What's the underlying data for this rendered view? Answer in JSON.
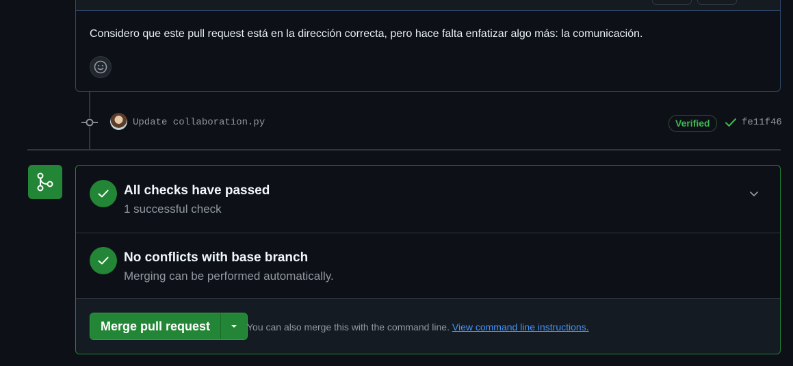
{
  "comment": {
    "body": "Considero que este pull request está en la dirección correcta, pero hace falta enfatizar algo más: la comunicación.",
    "reaction_icon": "smiley-icon"
  },
  "commit": {
    "message": "Update collaboration.py",
    "badge": "Verified",
    "sha": "fe11f46",
    "status_icon": "check-icon"
  },
  "merge": {
    "icon": "git-merge-icon",
    "checks": {
      "title": "All checks have passed",
      "subtitle": "1 successful check",
      "icon": "check-circle-icon"
    },
    "conflicts": {
      "title": "No conflicts with base branch",
      "subtitle": "Merging can be performed automatically.",
      "icon": "check-circle-icon"
    },
    "button_label": "Merge pull request",
    "footer_text": "You can also merge this with the command line.",
    "footer_link": "View command line instructions."
  },
  "colors": {
    "background": "#0d1117",
    "success": "#238636",
    "success_text": "#3fb950",
    "link": "#4493f8",
    "border": "#30363d",
    "muted_text": "#9198a1"
  }
}
